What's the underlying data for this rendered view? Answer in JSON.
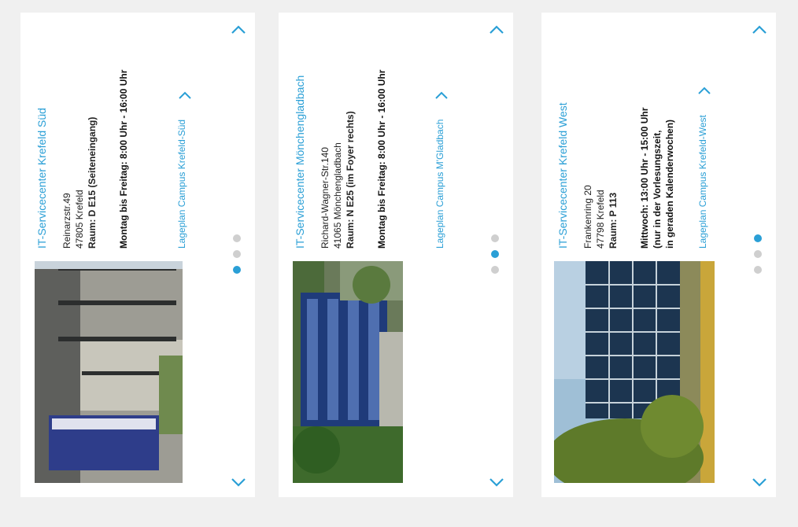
{
  "colors": {
    "accent": "#2a9fd6",
    "background": "#f0f0f0",
    "card": "#ffffff",
    "dot_inactive": "#cfcfcf"
  },
  "cards": [
    {
      "title": "IT-Servicecenter Krefeld Süd",
      "street": "Reinarzstr.49",
      "city": "47805 Krefeld",
      "room": "Raum: D E15 (Seiteneingang)",
      "hours": [
        "Montag bis Freitag: 8:00 Uhr - 16:00 Uhr"
      ],
      "map_link": "Lageplan Campus Krefeld-Süd",
      "active_slide": 3,
      "slides": 3,
      "photo_icon": "building-photo"
    },
    {
      "title": "IT-Servicecenter Mönchengladbach",
      "street": "Richard-Wagner-Str.140",
      "city": "41065 Mönchengladbach",
      "room": "Raum: N E25 (im Foyer rechts)",
      "hours": [
        "Montag bis Freitag: 8:00 Uhr - 16:00 Uhr"
      ],
      "map_link": "Lageplan Campus M'Gladbach",
      "active_slide": 2,
      "slides": 3,
      "photo_icon": "building-photo"
    },
    {
      "title": "IT-Servicecenter Krefeld West",
      "street": "Frankenring 20",
      "city": "47798 Krefeld",
      "room": "Raum: P 113",
      "hours": [
        "Mittwoch: 13:00 Uhr - 15:00 Uhr",
        "(nur in der Vorlesungszeit,",
        "in geraden Kalenderwochen)"
      ],
      "map_link": "Lageplan Campus Krefeld-West",
      "active_slide": 1,
      "slides": 3,
      "photo_icon": "building-photo"
    }
  ]
}
